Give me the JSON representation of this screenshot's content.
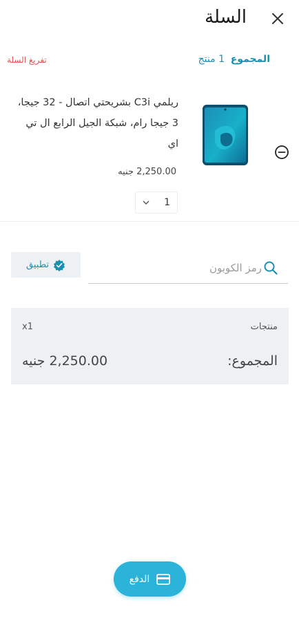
{
  "header": {
    "title": "السلة",
    "close_icon": "close-icon"
  },
  "summary": {
    "total_label": "المجموع",
    "item_count": "1 منتج",
    "clear_cart": "تفريغ السلة"
  },
  "product": {
    "name": "ريلمي C3i بشريحتي اتصال - 32 جيجا، 3 جيجا رام، شبكة الجيل الرابع ال تي اي",
    "price": "2,250.00 جنيه",
    "quantity": "1",
    "image_icon": "phone-image",
    "remove_icon": "remove-circle-icon"
  },
  "coupon": {
    "placeholder": "رمز الكوبون",
    "value": "",
    "apply_label": "تطبيق",
    "apply_icon": "verified-check-icon",
    "search_icon": "search-icon"
  },
  "totals": {
    "products_label": "منتجات",
    "quantity_label": "x1",
    "total_label": "المجموع:",
    "total_value": "2,250.00 جنيه"
  },
  "checkout": {
    "pay_label": "الدفع",
    "pay_icon": "credit-card-icon"
  },
  "colors": {
    "accent": "#2bb3d9",
    "accent_text": "#1b8fb0",
    "danger": "#e05050",
    "panel_bg": "#eef1f4"
  }
}
